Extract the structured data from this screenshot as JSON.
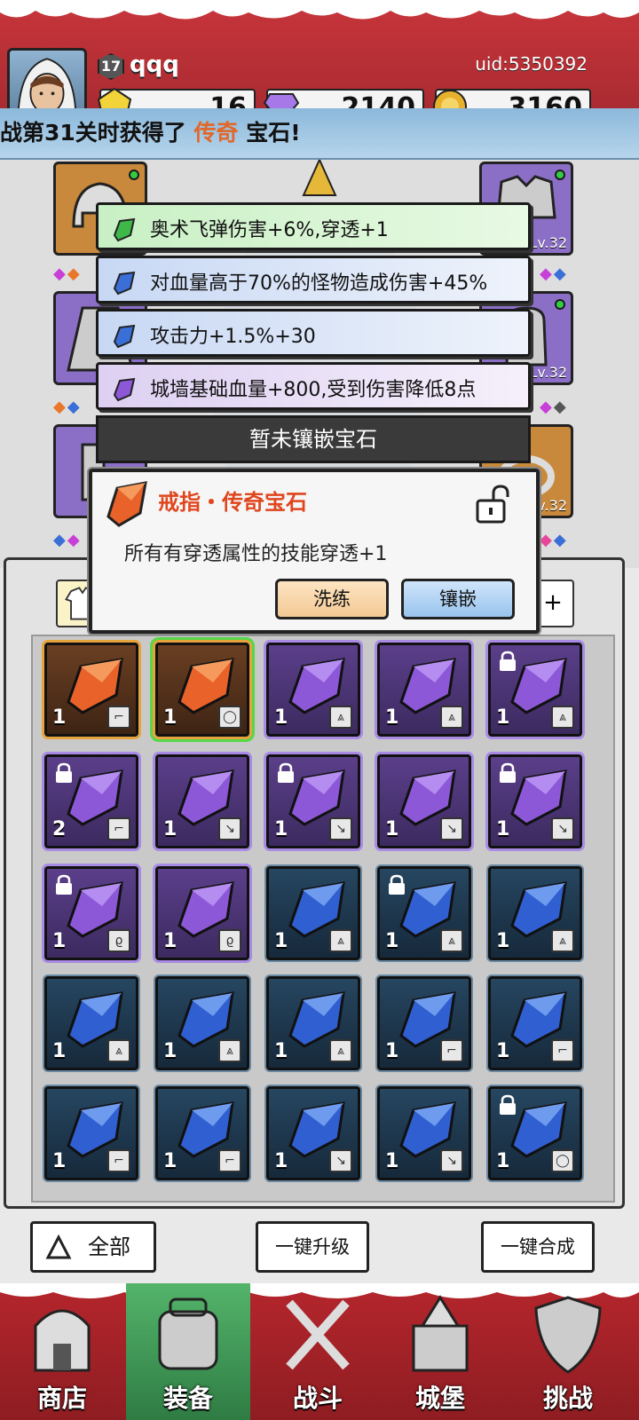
{
  "player": {
    "level": "17",
    "name": "qqq",
    "uid": "uid:5350392"
  },
  "resources": [
    {
      "name": "energy",
      "value": "16",
      "icon": "yellow-gem-icon",
      "color": "#f3d33a"
    },
    {
      "name": "diamonds",
      "value": "2140",
      "icon": "purple-diamond-icon",
      "color": "#a678e8"
    },
    {
      "name": "gold",
      "value": "3160",
      "icon": "gold-coin-icon",
      "color": "#e8b12c"
    }
  ],
  "marquee": {
    "prefix": "战第31关时获得了",
    "highlight": "传奇",
    "suffix": "宝石!"
  },
  "equipment": {
    "slots": [
      {
        "name": "helmet-slot",
        "rarity": "orange",
        "level": ""
      },
      {
        "name": "armor-slot",
        "rarity": "purple",
        "level": "Lv.32"
      },
      {
        "name": "cloak-slot",
        "rarity": "purple",
        "level": ""
      },
      {
        "name": "glove-slot",
        "rarity": "purple",
        "level": "Lv.32"
      },
      {
        "name": "boot-slot",
        "rarity": "purple",
        "level": ""
      },
      {
        "name": "ring-slot",
        "rarity": "orange",
        "level": "Lv.32"
      }
    ]
  },
  "gem_stats": [
    {
      "text": "奥术飞弹伤害+6%,穿透+1",
      "gem": "green"
    },
    {
      "text": "对血量高于70%的怪物造成伤害+45%",
      "gem": "blue"
    },
    {
      "text": "攻击力+1.5%+30",
      "gem": "blue"
    },
    {
      "text": "城墙基础血量+800,受到伤害降低8点",
      "gem": "purple"
    }
  ],
  "empty_socket": "暂未镶嵌宝石",
  "popup": {
    "title": "戒指・传奇宝石",
    "description": "所有有穿透属性的技能穿透+1",
    "refine_label": "洗练",
    "inlay_label": "镶嵌"
  },
  "inventory": [
    {
      "rarity": "legend",
      "count": "1",
      "type": "boot",
      "locked": false,
      "selected": false
    },
    {
      "rarity": "legend",
      "count": "1",
      "type": "ring",
      "locked": false,
      "selected": true
    },
    {
      "rarity": "epic",
      "count": "1",
      "type": "armor",
      "locked": false
    },
    {
      "rarity": "epic",
      "count": "1",
      "type": "armor",
      "locked": false
    },
    {
      "rarity": "epic",
      "count": "1",
      "type": "armor",
      "locked": true
    },
    {
      "rarity": "epic",
      "count": "2",
      "type": "boot",
      "locked": true
    },
    {
      "rarity": "epic",
      "count": "1",
      "type": "wand",
      "locked": false
    },
    {
      "rarity": "epic",
      "count": "1",
      "type": "wand",
      "locked": true
    },
    {
      "rarity": "epic",
      "count": "1",
      "type": "wand",
      "locked": false
    },
    {
      "rarity": "epic",
      "count": "1",
      "type": "wand",
      "locked": true
    },
    {
      "rarity": "epic",
      "count": "1",
      "type": "necklace",
      "locked": true
    },
    {
      "rarity": "epic",
      "count": "1",
      "type": "necklace",
      "locked": false
    },
    {
      "rarity": "rare",
      "count": "1",
      "type": "cloak",
      "locked": false
    },
    {
      "rarity": "rare",
      "count": "1",
      "type": "cloak",
      "locked": true
    },
    {
      "rarity": "rare",
      "count": "1",
      "type": "cloak",
      "locked": false
    },
    {
      "rarity": "rare",
      "count": "1",
      "type": "armor",
      "locked": false
    },
    {
      "rarity": "rare",
      "count": "1",
      "type": "armor",
      "locked": false
    },
    {
      "rarity": "rare",
      "count": "1",
      "type": "armor",
      "locked": false
    },
    {
      "rarity": "rare",
      "count": "1",
      "type": "boot",
      "locked": false
    },
    {
      "rarity": "rare",
      "count": "1",
      "type": "boot",
      "locked": false
    },
    {
      "rarity": "rare",
      "count": "1",
      "type": "boot",
      "locked": false
    },
    {
      "rarity": "rare",
      "count": "1",
      "type": "boot",
      "locked": false
    },
    {
      "rarity": "rare",
      "count": "1",
      "type": "wand",
      "locked": false
    },
    {
      "rarity": "rare",
      "count": "1",
      "type": "wand",
      "locked": false
    },
    {
      "rarity": "rare",
      "count": "1",
      "type": "ring",
      "locked": true
    }
  ],
  "actions": {
    "filter_label": "全部",
    "upgrade_label": "一键升级",
    "merge_label": "一键合成"
  },
  "nav": [
    {
      "label": "商店",
      "icon": "shop-icon",
      "active": false
    },
    {
      "label": "装备",
      "icon": "backpack-icon",
      "active": true
    },
    {
      "label": "战斗",
      "icon": "crossed-swords-icon",
      "active": false
    },
    {
      "label": "城堡",
      "icon": "castle-icon",
      "active": false
    },
    {
      "label": "挑战",
      "icon": "shield-icon",
      "active": false
    }
  ]
}
